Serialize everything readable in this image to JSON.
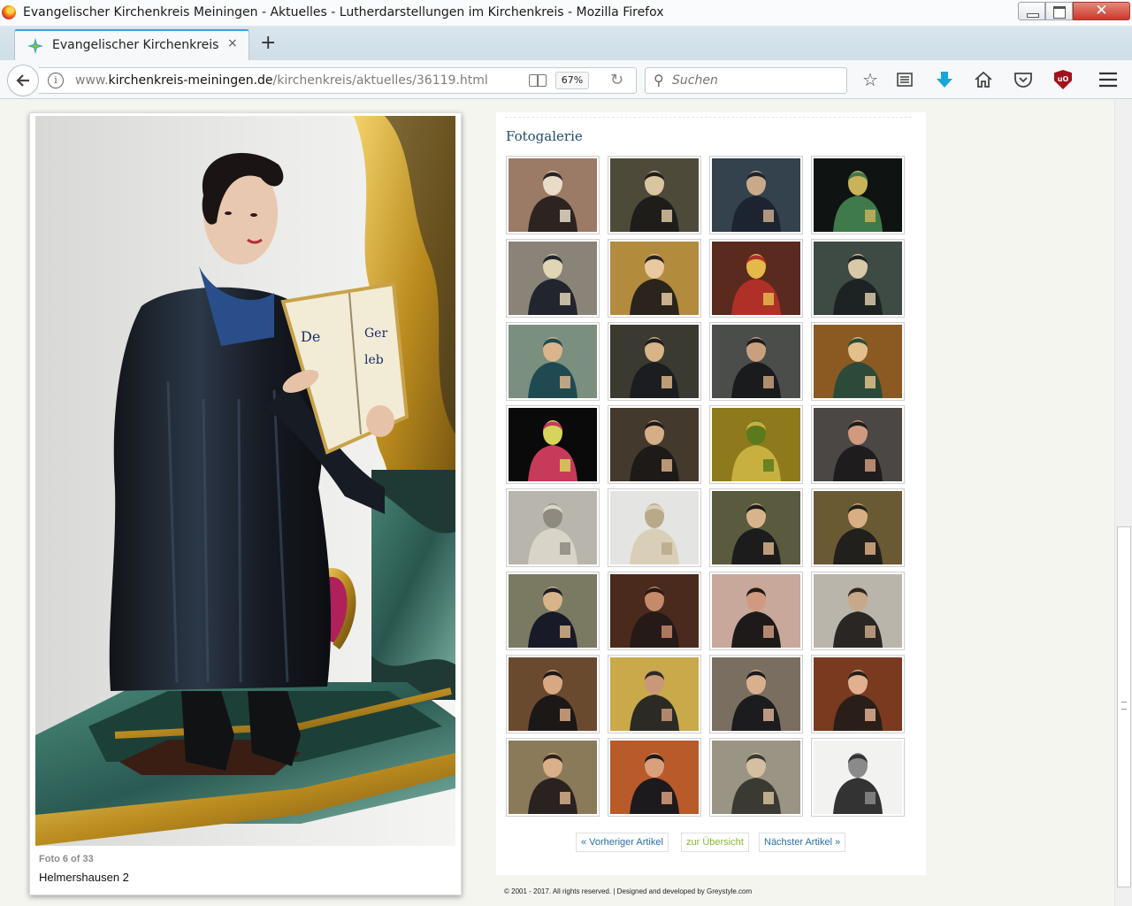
{
  "window": {
    "title": "Evangelischer Kirchenkreis Meiningen - Aktuelles - Lutherdarstellungen im Kirchenkreis - Mozilla Firefox"
  },
  "tab": {
    "title": "Evangelischer Kirchenkreis M",
    "close": "×",
    "new_tab": "+"
  },
  "navbar": {
    "url_prefix": "www.",
    "url_host": "kirchenkreis-meiningen.de",
    "url_path": "/kirchenkreis/aktuelles/36119.html",
    "zoom": "67%",
    "search_placeholder": "Suchen"
  },
  "lightbox": {
    "counter": "Foto 6 of 33",
    "caption": "Helmershausen 2"
  },
  "gallery": {
    "heading": "Fotogalerie",
    "thumbnails": [
      {
        "name": "Luther portrait 1",
        "bg": "#9b7a66",
        "figure": "#2c2420",
        "accent": "#e8dcc8"
      },
      {
        "name": "Luther portrait 2",
        "bg": "#4e4a3a",
        "figure": "#1f1d1a",
        "accent": "#d9c5a0"
      },
      {
        "name": "Luther portrait 3",
        "bg": "#33424c",
        "figure": "#1b2430",
        "accent": "#c8a98a"
      },
      {
        "name": "Stained glass window",
        "bg": "#0f1412",
        "figure": "#3f7a4a",
        "accent": "#c8b25a"
      },
      {
        "name": "Luther statue with book",
        "bg": "#8a8378",
        "figure": "#22252e",
        "accent": "#e0d5b5"
      },
      {
        "name": "Framed portrait",
        "bg": "#b38b3c",
        "figure": "#2a241c",
        "accent": "#e8c9a0"
      },
      {
        "name": "Altar scene",
        "bg": "#5a2a1e",
        "figure": "#b03028",
        "accent": "#e4b94a"
      },
      {
        "name": "Luther with book",
        "bg": "#3e4a44",
        "figure": "#1d2322",
        "accent": "#d8c9a8"
      },
      {
        "name": "Painted portrait green",
        "bg": "#7b8f7f",
        "figure": "#1f4a52",
        "accent": "#d9b58c"
      },
      {
        "name": "Luther portrait dark",
        "bg": "#3a3a30",
        "figure": "#1c1d20",
        "accent": "#d8b486"
      },
      {
        "name": "Luther portrait grey",
        "bg": "#4a4d4a",
        "figure": "#1a1b1d",
        "accent": "#c9a07e"
      },
      {
        "name": "Gilt framed portrait",
        "bg": "#8a5a22",
        "figure": "#2c4a3a",
        "accent": "#e2c08c"
      },
      {
        "name": "Luther rose window",
        "bg": "#0a0a0a",
        "figure": "#c83a5a",
        "accent": "#d6d45a"
      },
      {
        "name": "Luther half figure",
        "bg": "#43392c",
        "figure": "#1d1a17",
        "accent": "#d5ae86"
      },
      {
        "name": "Golden relief",
        "bg": "#8e7a1c",
        "figure": "#c8b040",
        "accent": "#5a7a1c"
      },
      {
        "name": "Luther portrait red",
        "bg": "#4a4744",
        "figure": "#1e1c1c",
        "accent": "#cf9a80"
      },
      {
        "name": "Stone statue",
        "bg": "#b8b5ac",
        "figure": "#d8d4c8",
        "accent": "#8e8a80"
      },
      {
        "name": "White bust",
        "bg": "#e4e4e2",
        "figure": "#d9cfb8",
        "accent": "#b8a988"
      },
      {
        "name": "Luther painting with bible",
        "bg": "#5a5a3e",
        "figure": "#1c1c1c",
        "accent": "#d8b48c"
      },
      {
        "name": "Luther painting 20",
        "bg": "#6a5a34",
        "figure": "#22201c",
        "accent": "#d8ae84"
      },
      {
        "name": "Luther painting 21",
        "bg": "#7a7a62",
        "figure": "#181a28",
        "accent": "#d8b48a"
      },
      {
        "name": "Luther painting 22",
        "bg": "#4a2a1c",
        "figure": "#261a16",
        "accent": "#c48a6a"
      },
      {
        "name": "Luther painting 23",
        "bg": "#c8a89a",
        "figure": "#1e1a1a",
        "accent": "#d09a80"
      },
      {
        "name": "Luther painting 24",
        "bg": "#b9b5aa",
        "figure": "#2a2624",
        "accent": "#c8a88a"
      },
      {
        "name": "Luther painting 25",
        "bg": "#6a4a2e",
        "figure": "#1c1818",
        "accent": "#d8a884"
      },
      {
        "name": "Luther painting 26",
        "bg": "#caa94a",
        "figure": "#2c2a24",
        "accent": "#c89878"
      },
      {
        "name": "Luther painting 27",
        "bg": "#7a6e60",
        "figure": "#1c1b1e",
        "accent": "#d8b090"
      },
      {
        "name": "Luther painting 28",
        "bg": "#7a3a20",
        "figure": "#2a1e18",
        "accent": "#e0b090"
      },
      {
        "name": "Luther painting 29",
        "bg": "#8a7a5a",
        "figure": "#2a2220",
        "accent": "#d9b089"
      },
      {
        "name": "Luther painting 30",
        "bg": "#b85a2a",
        "figure": "#1c1a1c",
        "accent": "#d8a07c"
      },
      {
        "name": "Luther painting 31",
        "bg": "#9a9484",
        "figure": "#3a3a32",
        "accent": "#d4c0a0"
      },
      {
        "name": "Luther bust photo",
        "bg": "#f2f2f0",
        "figure": "#333333",
        "accent": "#8a8a8a"
      }
    ]
  },
  "pagination": {
    "prev": "« Vorheriger Artikel",
    "overview": "zur Übersicht",
    "next": "Nächster Artikel »"
  },
  "footer": {
    "text": "© 2001 - 2017. All rights reserved. | Designed and developed by Greystyle.com"
  },
  "colors": {
    "heading": "#214d6c",
    "link": "#2b6fa3",
    "overview_link": "#8ab734",
    "firefox_accent": "#3fa0e0"
  }
}
